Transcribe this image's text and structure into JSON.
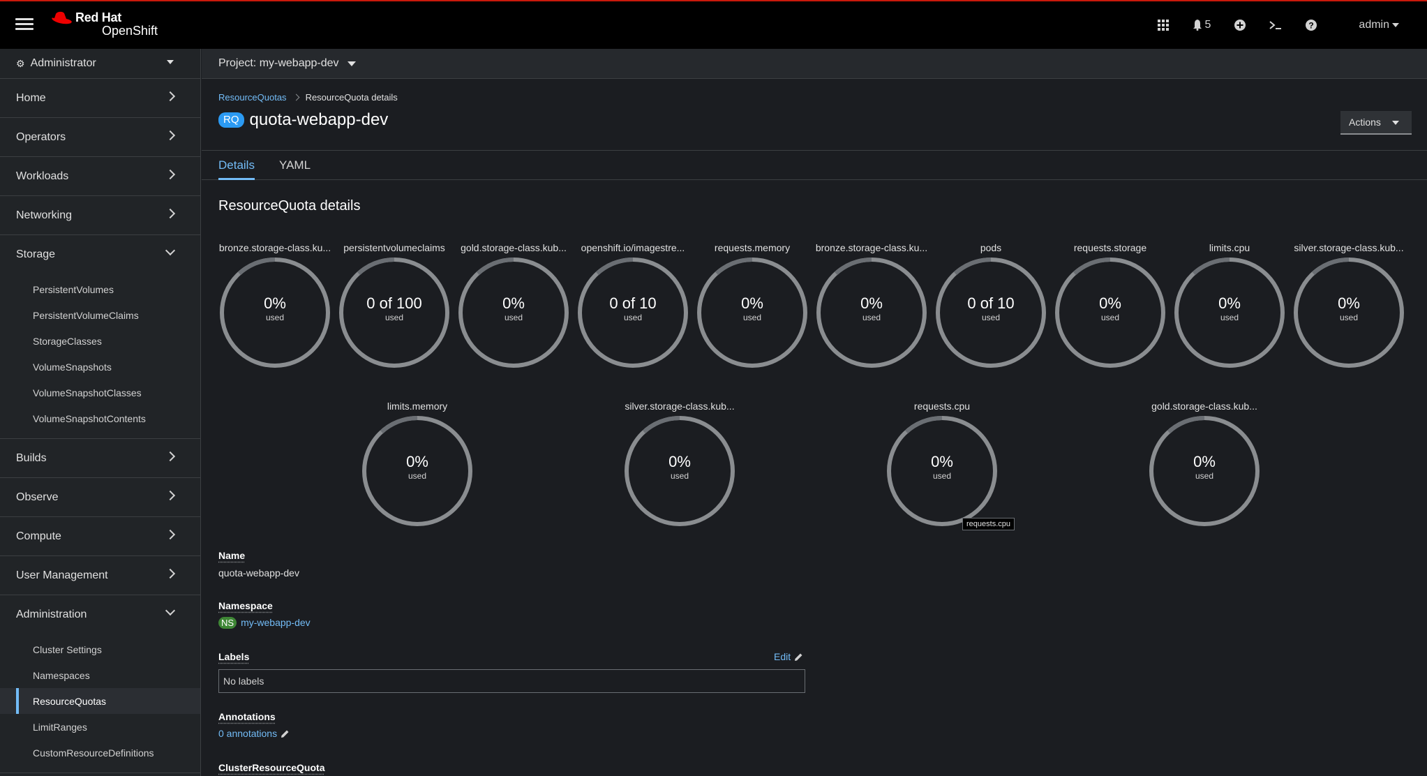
{
  "masthead": {
    "brand_line1": "Red Hat",
    "brand_line2": "OpenShift",
    "notifications_count": "5",
    "user": "admin"
  },
  "sidebar": {
    "perspective": "Administrator",
    "sections": [
      {
        "label": "Home",
        "expanded": false
      },
      {
        "label": "Operators",
        "expanded": false
      },
      {
        "label": "Workloads",
        "expanded": false
      },
      {
        "label": "Networking",
        "expanded": false
      },
      {
        "label": "Storage",
        "expanded": true
      },
      {
        "label": "Builds",
        "expanded": false
      },
      {
        "label": "Observe",
        "expanded": false
      },
      {
        "label": "Compute",
        "expanded": false
      },
      {
        "label": "User Management",
        "expanded": false
      },
      {
        "label": "Administration",
        "expanded": true
      }
    ],
    "storage_items": [
      "PersistentVolumes",
      "PersistentVolumeClaims",
      "StorageClasses",
      "VolumeSnapshots",
      "VolumeSnapshotClasses",
      "VolumeSnapshotContents"
    ],
    "administration_items": [
      "Cluster Settings",
      "Namespaces",
      "ResourceQuotas",
      "LimitRanges",
      "CustomResourceDefinitions"
    ],
    "active_item": "ResourceQuotas"
  },
  "project_bar": {
    "label": "Project: my-webapp-dev"
  },
  "breadcrumb": {
    "parent": "ResourceQuotas",
    "current": "ResourceQuota details"
  },
  "header": {
    "badge": "RQ",
    "title": "quota-webapp-dev",
    "actions_label": "Actions"
  },
  "tabs": [
    {
      "label": "Details",
      "active": true
    },
    {
      "label": "YAML",
      "active": false
    }
  ],
  "details": {
    "section_title": "ResourceQuota details",
    "used_label": "used",
    "gauges_row1": [
      {
        "label": "bronze.storage-class.ku...",
        "value": "0%"
      },
      {
        "label": "persistentvolumeclaims",
        "value": "0 of 100"
      },
      {
        "label": "gold.storage-class.kub...",
        "value": "0%"
      },
      {
        "label": "openshift.io/imagestre...",
        "value": "0 of 10"
      },
      {
        "label": "requests.memory",
        "value": "0%"
      },
      {
        "label": "bronze.storage-class.ku...",
        "value": "0%"
      },
      {
        "label": "pods",
        "value": "0 of 10"
      },
      {
        "label": "requests.storage",
        "value": "0%"
      },
      {
        "label": "limits.cpu",
        "value": "0%"
      },
      {
        "label": "silver.storage-class.kub...",
        "value": "0%"
      }
    ],
    "gauges_row2": [
      {
        "label": "limits.memory",
        "value": "0%"
      },
      {
        "label": "silver.storage-class.kub...",
        "value": "0%"
      },
      {
        "label": "requests.cpu",
        "value": "0%"
      },
      {
        "label": "gold.storage-class.kub...",
        "value": "0%"
      }
    ],
    "tooltip": "requests.cpu",
    "name_label": "Name",
    "name_value": "quota-webapp-dev",
    "namespace_label": "Namespace",
    "namespace_badge": "NS",
    "namespace_value": "my-webapp-dev",
    "labels_label": "Labels",
    "labels_edit": "Edit",
    "labels_value": "No labels",
    "annotations_label": "Annotations",
    "annotations_value": "0 annotations",
    "crq_label": "ClusterResourceQuota"
  },
  "colors": {
    "accent": "#73bcf7",
    "rq_badge": "#2b9af3",
    "ns_badge": "#3e8635",
    "gauge_ring": "#8a8d90"
  }
}
